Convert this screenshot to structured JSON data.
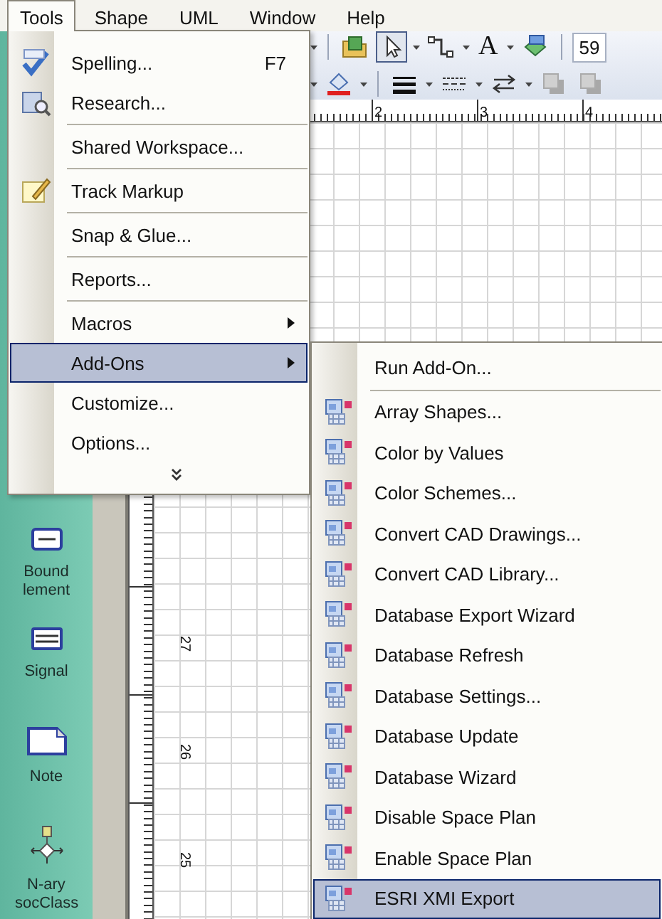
{
  "menubar": {
    "items": [
      {
        "label": "Tools",
        "selected": true
      },
      {
        "label": "Shape",
        "selected": false
      },
      {
        "label": "UML",
        "selected": false
      },
      {
        "label": "Window",
        "selected": false
      },
      {
        "label": "Help",
        "selected": false
      }
    ]
  },
  "toolbars": [
    {
      "items": [
        {
          "kind": "dropdown"
        },
        {
          "kind": "separator"
        },
        {
          "kind": "folder",
          "pressed": false
        },
        {
          "kind": "pointer",
          "pressed": true
        },
        {
          "kind": "dropdown"
        },
        {
          "kind": "connector",
          "pressed": false
        },
        {
          "kind": "dropdown"
        },
        {
          "kind": "text",
          "label": "A"
        },
        {
          "kind": "dropdown"
        },
        {
          "kind": "fill",
          "pressed": false
        },
        {
          "kind": "separator"
        },
        {
          "kind": "field",
          "value": "59"
        }
      ]
    },
    {
      "items": [
        {
          "kind": "dropdown"
        },
        {
          "kind": "bucket",
          "pressed": false
        },
        {
          "kind": "dropdown"
        },
        {
          "kind": "separator"
        },
        {
          "kind": "lineweight",
          "pressed": false
        },
        {
          "kind": "dropdown"
        },
        {
          "kind": "linepattern",
          "pressed": false
        },
        {
          "kind": "dropdown"
        },
        {
          "kind": "lineends",
          "pressed": false
        },
        {
          "kind": "dropdown"
        },
        {
          "kind": "shadow",
          "pressed": false
        },
        {
          "kind": "shadow",
          "pressed": false
        }
      ]
    }
  ],
  "horizontal_ruler": {
    "labels": [
      "2",
      "3",
      "4"
    ]
  },
  "vertical_ruler": {
    "labels": [
      "27",
      "26",
      "25"
    ]
  },
  "stencil": {
    "shapes": [
      {
        "label": "Bound lement",
        "kind": "bound"
      },
      {
        "label": "Signal",
        "kind": "signal"
      },
      {
        "label": "Note",
        "kind": "note"
      },
      {
        "label": "N-ary socClass",
        "kind": "nary"
      }
    ]
  },
  "tools_menu": {
    "items": [
      {
        "kind": "spelling",
        "label": "Spelling...",
        "shortcut": "F7",
        "submenu": false,
        "selected": false
      },
      {
        "kind": "research",
        "label": "Research...",
        "submenu": false,
        "selected": false
      },
      {
        "kind": "separator"
      },
      {
        "kind": "command",
        "label": "Shared Workspace...",
        "submenu": false,
        "selected": false
      },
      {
        "kind": "separator"
      },
      {
        "kind": "markup",
        "label": "Track Markup",
        "submenu": false,
        "selected": false
      },
      {
        "kind": "separator"
      },
      {
        "kind": "command",
        "label": "Snap & Glue...",
        "submenu": false,
        "selected": false
      },
      {
        "kind": "separator"
      },
      {
        "kind": "command",
        "label": "Reports...",
        "submenu": false,
        "selected": false
      },
      {
        "kind": "separator"
      },
      {
        "kind": "command",
        "label": "Macros",
        "submenu": true,
        "selected": false
      },
      {
        "kind": "command",
        "label": "Add-Ons",
        "submenu": true,
        "selected": true
      },
      {
        "kind": "command",
        "label": "Customize...",
        "submenu": false,
        "selected": false
      },
      {
        "kind": "command",
        "label": "Options...",
        "submenu": false,
        "selected": false
      },
      {
        "kind": "more"
      }
    ]
  },
  "addons_submenu": {
    "items": [
      {
        "kind": "command",
        "label": "Run Add-On...",
        "submenu": false,
        "selected": false
      },
      {
        "kind": "separator"
      },
      {
        "kind": "addon",
        "label": "Array Shapes...",
        "submenu": false,
        "selected": false
      },
      {
        "kind": "addon",
        "label": "Color by Values",
        "submenu": false,
        "selected": false
      },
      {
        "kind": "addon",
        "label": "Color Schemes...",
        "submenu": false,
        "selected": false
      },
      {
        "kind": "addon",
        "label": "Convert CAD Drawings...",
        "submenu": false,
        "selected": false
      },
      {
        "kind": "addon",
        "label": "Convert CAD Library...",
        "submenu": false,
        "selected": false
      },
      {
        "kind": "addon",
        "label": "Database Export Wizard",
        "submenu": false,
        "selected": false
      },
      {
        "kind": "addon",
        "label": "Database Refresh",
        "submenu": false,
        "selected": false
      },
      {
        "kind": "addon",
        "label": "Database Settings...",
        "submenu": false,
        "selected": false
      },
      {
        "kind": "addon",
        "label": "Database Update",
        "submenu": false,
        "selected": false
      },
      {
        "kind": "addon",
        "label": "Database Wizard",
        "submenu": false,
        "selected": false
      },
      {
        "kind": "addon",
        "label": "Disable Space Plan",
        "submenu": false,
        "selected": false
      },
      {
        "kind": "addon",
        "label": "Enable Space Plan",
        "submenu": false,
        "selected": false
      },
      {
        "kind": "addon",
        "label": "ESRI XMI Export",
        "submenu": false,
        "selected": true
      }
    ]
  }
}
